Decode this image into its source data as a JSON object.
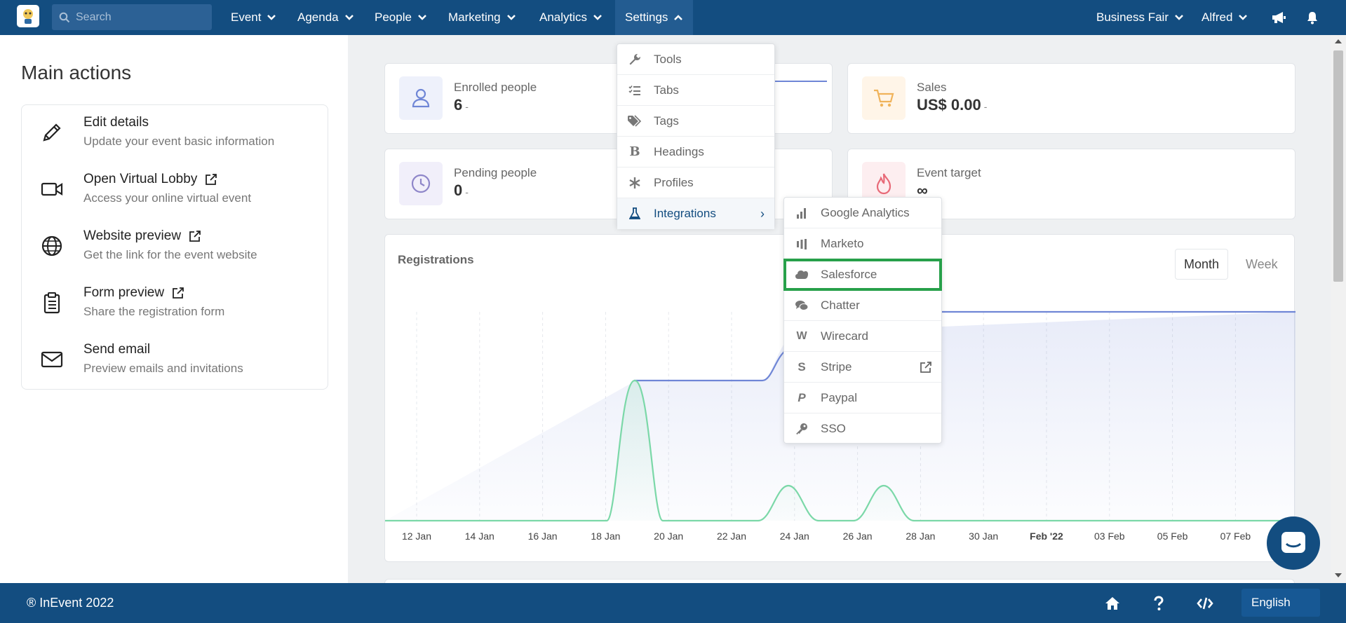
{
  "nav": {
    "search_placeholder": "Search",
    "items": [
      {
        "label": "Event"
      },
      {
        "label": "Agenda"
      },
      {
        "label": "People"
      },
      {
        "label": "Marketing"
      },
      {
        "label": "Analytics"
      },
      {
        "label": "Settings"
      }
    ],
    "event_name": "Business Fair",
    "user_name": "Alfred"
  },
  "main_actions": {
    "title": "Main actions",
    "items": [
      {
        "title": "Edit details",
        "subtitle": "Update your event basic information",
        "icon": "pencil-icon"
      },
      {
        "title": "Open Virtual Lobby",
        "subtitle": "Access your online virtual event",
        "icon": "video-camera-icon"
      },
      {
        "title": "Website preview",
        "subtitle": "Get the link for the event website",
        "icon": "globe-icon"
      },
      {
        "title": "Form preview",
        "subtitle": "Share the registration form",
        "icon": "clipboard-icon"
      },
      {
        "title": "Send email",
        "subtitle": "Preview emails and invitations",
        "icon": "envelope-icon"
      }
    ]
  },
  "stats": {
    "enrolled": {
      "label": "Enrolled people",
      "value": "6",
      "trend": "-"
    },
    "sales": {
      "label": "Sales",
      "value": "US$ 0.00",
      "trend": "-"
    },
    "pending": {
      "label": "Pending people",
      "value": "0",
      "trend": "-"
    },
    "target": {
      "label": "Event target",
      "value": "∞"
    }
  },
  "settings_menu": {
    "items": [
      {
        "label": "Tools",
        "icon": "wrench-icon"
      },
      {
        "label": "Tabs",
        "icon": "list-check-icon"
      },
      {
        "label": "Tags",
        "icon": "tags-icon"
      },
      {
        "label": "Headings",
        "icon": "bold-icon"
      },
      {
        "label": "Profiles",
        "icon": "asterisk-icon"
      },
      {
        "label": "Integrations",
        "icon": "flask-icon",
        "arrow": "›"
      }
    ]
  },
  "integrations_menu": {
    "items": [
      {
        "label": "Google Analytics",
        "icon": "bar-chart-icon"
      },
      {
        "label": "Marketo",
        "icon": "marketo-icon"
      },
      {
        "label": "Salesforce",
        "icon": "salesforce-cloud-icon"
      },
      {
        "label": "Chatter",
        "icon": "chat-bubbles-icon"
      },
      {
        "label": "Wirecard",
        "icon": "wirecard-icon"
      },
      {
        "label": "Stripe",
        "icon": "stripe-icon"
      },
      {
        "label": "Paypal",
        "icon": "paypal-icon"
      },
      {
        "label": "SSO",
        "icon": "key-icon"
      }
    ]
  },
  "registrations": {
    "title": "Registrations",
    "toggle": {
      "month": "Month",
      "week": "Week",
      "selected": "Month"
    }
  },
  "chart_data": {
    "type": "line",
    "x_labels": [
      "12 Jan",
      "14 Jan",
      "16 Jan",
      "18 Jan",
      "20 Jan",
      "22 Jan",
      "24 Jan",
      "26 Jan",
      "28 Jan",
      "30 Jan",
      "Feb '22",
      "03 Feb",
      "05 Feb",
      "07 Feb"
    ],
    "series": [
      {
        "color": "#6f86d6",
        "description": "cumulative"
      },
      {
        "color": "#7bd8a8",
        "description": "daily"
      }
    ],
    "grid": true
  },
  "footer": {
    "copyright": "® InEvent 2022",
    "language": "English"
  },
  "colors": {
    "brand": "#134d80",
    "highlight": "#27a04a"
  }
}
